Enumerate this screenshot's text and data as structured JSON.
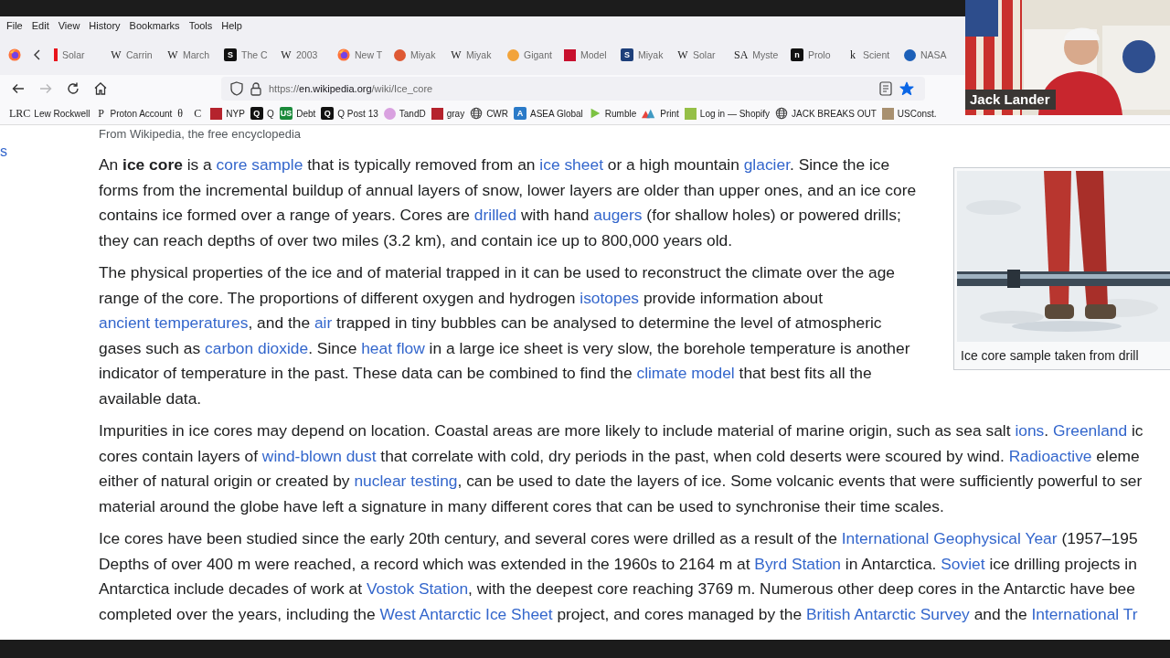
{
  "menu_bar": [
    "File",
    "Edit",
    "View",
    "History",
    "Bookmarks",
    "Tools",
    "Help"
  ],
  "tab_strip": {
    "tabs": [
      {
        "label": "Solar",
        "selected": false,
        "icon": {
          "kind": "bar",
          "color": "#e8141c"
        }
      },
      {
        "label": "Carrin",
        "selected": false,
        "icon": {
          "kind": "glyph",
          "glyph": "W"
        }
      },
      {
        "label": "March",
        "selected": false,
        "icon": {
          "kind": "glyph",
          "glyph": "W"
        }
      },
      {
        "label": "The C",
        "selected": false,
        "icon": {
          "kind": "badge",
          "glyph": "S",
          "color": "#111111"
        }
      },
      {
        "label": "2003",
        "selected": false,
        "icon": {
          "kind": "glyph",
          "glyph": "W"
        }
      },
      {
        "label": "New T",
        "selected": false,
        "icon": {
          "kind": "firefox"
        }
      },
      {
        "label": "Miyak",
        "selected": false,
        "icon": {
          "kind": "circle",
          "color": "#de5833"
        }
      },
      {
        "label": "Miyak",
        "selected": false,
        "icon": {
          "kind": "glyph",
          "glyph": "W"
        }
      },
      {
        "label": "Gigant",
        "selected": false,
        "icon": {
          "kind": "circle",
          "color": "#f2a33a"
        }
      },
      {
        "label": "Model",
        "selected": false,
        "icon": {
          "kind": "square",
          "color": "#c8102e"
        }
      },
      {
        "label": "Miyak",
        "selected": false,
        "icon": {
          "kind": "badge",
          "glyph": "S",
          "color": "#1d3f7a"
        }
      },
      {
        "label": "Solar",
        "selected": false,
        "icon": {
          "kind": "glyph",
          "glyph": "W"
        }
      },
      {
        "label": "Myste",
        "selected": false,
        "icon": {
          "kind": "glyph",
          "glyph": "SA"
        }
      },
      {
        "label": "Prolo",
        "selected": false,
        "icon": {
          "kind": "badge",
          "glyph": "n",
          "color": "#111111"
        }
      },
      {
        "label": "Scient",
        "selected": false,
        "icon": {
          "kind": "glyph",
          "glyph": "k"
        }
      },
      {
        "label": "NASA",
        "selected": false,
        "icon": {
          "kind": "circle",
          "color": "#1b5fb8"
        }
      }
    ]
  },
  "toolbar": {
    "back_disabled": false,
    "forward_disabled": true,
    "url": {
      "scheme": "https://",
      "host": "en.wikipedia.org",
      "path": "/wiki/Ice_core"
    },
    "bookmarked": true
  },
  "bookmarks": [
    {
      "label": "Lew Rockwell",
      "icon": {
        "kind": "glyph",
        "glyph": "LRC"
      }
    },
    {
      "label": "Proton Account",
      "icon": {
        "kind": "glyph",
        "glyph": "P"
      }
    },
    {
      "icon": {
        "kind": "glyph",
        "glyph": "θ"
      }
    },
    {
      "icon": {
        "kind": "glyph",
        "glyph": "C"
      }
    },
    {
      "label": "NYP",
      "icon": {
        "kind": "square",
        "color": "#b5232d"
      }
    },
    {
      "label": "Q",
      "icon": {
        "kind": "badge",
        "glyph": "Q",
        "color": "#111111"
      }
    },
    {
      "label": "Debt",
      "icon": {
        "kind": "badge",
        "glyph": "US",
        "color": "#1a8a3a"
      }
    },
    {
      "label": "Q Post 13",
      "icon": {
        "kind": "badge",
        "glyph": "Q",
        "color": "#111111"
      }
    },
    {
      "label": "TandD",
      "icon": {
        "kind": "circle",
        "color": "#d9a1e0"
      }
    },
    {
      "label": "gray",
      "icon": {
        "kind": "square",
        "color": "#b5232d"
      }
    },
    {
      "label": "CWR",
      "icon": {
        "kind": "globe"
      }
    },
    {
      "label": "ASEA Global",
      "icon": {
        "kind": "badge",
        "glyph": "A",
        "color": "#2a7ac8"
      }
    },
    {
      "label": "Rumble",
      "icon": {
        "kind": "play",
        "color": "#7cc242"
      }
    },
    {
      "label": "Print",
      "icon": {
        "kind": "triangles"
      }
    },
    {
      "label": "Log in — Shopify",
      "icon": {
        "kind": "square",
        "color": "#95bf47"
      }
    },
    {
      "label": "JACK BREAKS OUT",
      "icon": {
        "kind": "globe"
      }
    },
    {
      "label": "USConst.",
      "icon": {
        "kind": "square",
        "color": "#a89070"
      }
    }
  ],
  "article": {
    "sidebar_fragment": "s",
    "subtitle": "From Wikipedia, the free encyclopedia",
    "figure": {
      "caption": "Ice core sample taken from drill"
    },
    "paragraphs": [
      {
        "runs": [
          {
            "kind": "text",
            "text": "An **ice core** is a "
          },
          {
            "kind": "link",
            "text": "core sample"
          },
          {
            "kind": "text",
            "text": " that is typically removed from an "
          },
          {
            "kind": "link",
            "text": "ice sheet"
          },
          {
            "kind": "text",
            "text": " or a high mountain "
          },
          {
            "kind": "link",
            "text": "glacier"
          },
          {
            "kind": "text",
            "text": ". Since the ice forms from the incremental buildup of annual layers of snow, lower layers are older than upper ones, and an ice core contains ice formed over a range of years. Cores are "
          },
          {
            "kind": "link",
            "text": "drilled"
          },
          {
            "kind": "text",
            "text": " with hand "
          },
          {
            "kind": "link",
            "text": "augers"
          },
          {
            "kind": "text",
            "text": " (for shallow holes) or powered drills; they can reach depths of over two miles (3.2 km), and contain ice up to 800,000 years old."
          }
        ]
      },
      {
        "runs": [
          {
            "kind": "text",
            "text": "The physical properties of the ice and of material trapped in it can be used to reconstruct the climate over the age range of the core. The proportions of different oxygen and hydrogen "
          },
          {
            "kind": "link",
            "text": "isotopes"
          },
          {
            "kind": "text",
            "text": " provide information about "
          },
          {
            "kind": "link",
            "text": "ancient temperatures"
          },
          {
            "kind": "text",
            "text": ", and the "
          },
          {
            "kind": "link",
            "text": "air"
          },
          {
            "kind": "text",
            "text": " trapped in tiny bubbles can be analysed to determine the level of atmospheric gases such as "
          },
          {
            "kind": "link",
            "text": "carbon dioxide"
          },
          {
            "kind": "text",
            "text": ". Since "
          },
          {
            "kind": "link",
            "text": "heat flow"
          },
          {
            "kind": "text",
            "text": " in a large ice sheet is very slow, the borehole temperature is another indicator of temperature in the past. These data can be combined to find the "
          },
          {
            "kind": "link",
            "text": "climate model"
          },
          {
            "kind": "text",
            "text": " that best fits all the available data."
          }
        ]
      },
      {
        "lines": [
          [
            {
              "kind": "text",
              "text": "Impurities in ice cores may depend on location. Coastal areas are more likely to include material of marine origin, such as sea salt "
            },
            {
              "kind": "link",
              "text": "ions"
            },
            {
              "kind": "text",
              "text": ". "
            },
            {
              "kind": "link",
              "text": "Greenland"
            },
            {
              "kind": "text",
              "text": " ic"
            }
          ],
          [
            {
              "kind": "text",
              "text": "cores contain layers of "
            },
            {
              "kind": "link",
              "text": "wind-blown dust"
            },
            {
              "kind": "text",
              "text": " that correlate with cold, dry periods in the past, when cold deserts were scoured by wind. "
            },
            {
              "kind": "link",
              "text": "Radioactive"
            },
            {
              "kind": "text",
              "text": " eleme"
            }
          ],
          [
            {
              "kind": "text",
              "text": "either of natural origin or created by "
            },
            {
              "kind": "link",
              "text": "nuclear testing"
            },
            {
              "kind": "text",
              "text": ", can be used to date the layers of ice. Some volcanic events that were sufficiently powerful to ser"
            }
          ],
          [
            {
              "kind": "text",
              "text": "material around the globe have left a signature in many different cores that can be used to synchronise their time scales."
            }
          ]
        ]
      },
      {
        "lines": [
          [
            {
              "kind": "text",
              "text": "Ice cores have been studied since the early 20th century, and several cores were drilled as a result of the "
            },
            {
              "kind": "link",
              "text": "International Geophysical Year"
            },
            {
              "kind": "text",
              "text": " (1957–195"
            }
          ],
          [
            {
              "kind": "text",
              "text": "Depths of over 400 m were reached, a record which was extended in the 1960s to 2164 m at "
            },
            {
              "kind": "link",
              "text": "Byrd Station"
            },
            {
              "kind": "text",
              "text": " in Antarctica. "
            },
            {
              "kind": "link",
              "text": "Soviet"
            },
            {
              "kind": "text",
              "text": " ice drilling projects in"
            }
          ],
          [
            {
              "kind": "text",
              "text": "Antarctica include decades of work at "
            },
            {
              "kind": "link",
              "text": "Vostok Station"
            },
            {
              "kind": "text",
              "text": ", with the deepest core reaching 3769 m. Numerous other deep cores in the Antarctic have bee"
            }
          ],
          [
            {
              "kind": "text",
              "text": "completed over the years, including the "
            },
            {
              "kind": "link",
              "text": "West Antarctic Ice Sheet"
            },
            {
              "kind": "text",
              "text": " project, and cores managed by the "
            },
            {
              "kind": "link",
              "text": "British Antarctic Survey"
            },
            {
              "kind": "text",
              "text": " and the "
            },
            {
              "kind": "link",
              "text": "International Tr"
            }
          ]
        ]
      }
    ]
  },
  "video_overlay": {
    "participant_name": "Jack Lander"
  }
}
